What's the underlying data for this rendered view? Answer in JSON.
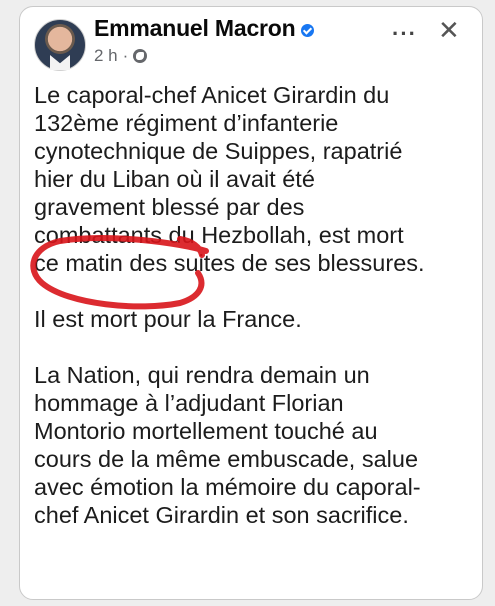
{
  "post": {
    "author": "Emmanuel Macron",
    "timestamp": "2 h",
    "separator": "·",
    "more_label": "···",
    "close_label": "✕",
    "icons": {
      "verified": "verified-badge-icon",
      "audience": "globe-icon",
      "more": "more-options-icon",
      "close": "close-icon"
    },
    "colors": {
      "verified": "#1877f2",
      "annotation": "#d8141a"
    },
    "paragraphs": [
      {
        "lines": [
          "Le caporal-chef Anicet Girardin du",
          "132ème régiment d’infanterie",
          "cynotechnique de Suippes, rapatrié",
          "hier du Liban où il avait été",
          "gravement blessé par des",
          "combattants du Hezbollah, est mort",
          "ce matin des suites de ses blessures."
        ]
      },
      {
        "lines": [
          "Il est mort pour la France."
        ]
      },
      {
        "lines": [
          "La Nation, qui rendra demain un",
          "hommage à l’adjudant Florian",
          "Montorio mortellement touché au",
          "cours de la même embuscade, salue",
          "avec émotion la mémoire du caporal-",
          "chef Anicet Girardin et son sacrifice."
        ]
      }
    ]
  }
}
